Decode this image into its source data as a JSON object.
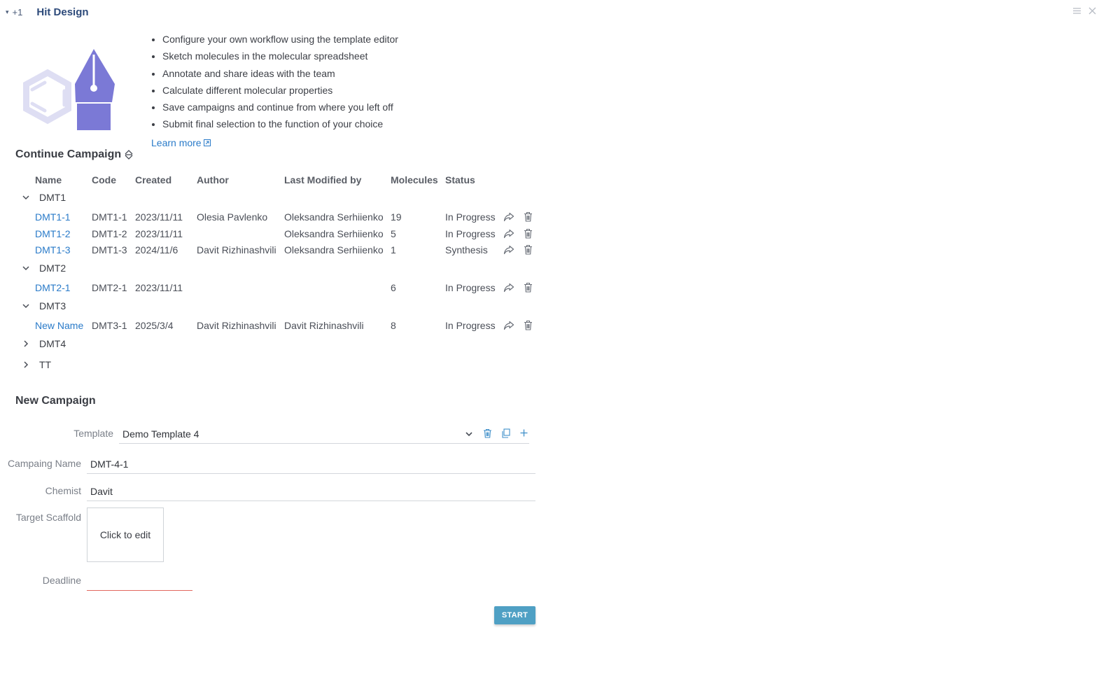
{
  "titlebar": {
    "caret": "▾",
    "plus": "+1",
    "title": "Hit Design"
  },
  "window_controls": {
    "menu_icon": "hamburger-icon",
    "close_icon": "close-icon"
  },
  "logo": {
    "icon": "hit-design-logo",
    "colors": {
      "pen": "#7b79d6",
      "hexagon": "#dedef3"
    }
  },
  "intro": {
    "bullets": [
      "Configure your own workflow using the template editor",
      "Sketch molecules in the molecular spreadsheet",
      "Annotate and share ideas with the team",
      "Calculate different molecular properties",
      "Save campaigns and continue from where you left off",
      "Submit final selection to the function of your choice"
    ],
    "learn_more": "Learn more"
  },
  "continue": {
    "title": "Continue Campaign",
    "columns": [
      "Name",
      "Code",
      "Created",
      "Author",
      "Last Modified by",
      "Molecules",
      "Status"
    ],
    "groups": [
      {
        "name": "DMT1",
        "expanded": true,
        "rows": [
          {
            "name": "DMT1-1",
            "code": "DMT1-1",
            "created": "2023/11/11",
            "author": "Olesia Pavlenko",
            "modified_by": "Oleksandra Serhiienko",
            "molecules": "19",
            "status": "In Progress"
          },
          {
            "name": "DMT1-2",
            "code": "DMT1-2",
            "created": "2023/11/11",
            "author": "",
            "modified_by": "Oleksandra Serhiienko",
            "molecules": "5",
            "status": "In Progress"
          },
          {
            "name": "DMT1-3",
            "code": "DMT1-3",
            "created": "2024/11/6",
            "author": "Davit Rizhinashvili",
            "modified_by": "Oleksandra Serhiienko",
            "molecules": "1",
            "status": "Synthesis"
          }
        ]
      },
      {
        "name": "DMT2",
        "expanded": true,
        "rows": [
          {
            "name": "DMT2-1",
            "code": "DMT2-1",
            "created": "2023/11/11",
            "author": "",
            "modified_by": "",
            "molecules": "6",
            "status": "In Progress"
          }
        ]
      },
      {
        "name": "DMT3",
        "expanded": true,
        "rows": [
          {
            "name": "New Name",
            "code": "DMT3-1",
            "created": "2025/3/4",
            "author": "Davit Rizhinashvili",
            "modified_by": "Davit Rizhinashvili",
            "molecules": "8",
            "status": "In Progress"
          }
        ]
      },
      {
        "name": "DMT4",
        "expanded": false,
        "rows": []
      },
      {
        "name": "TT",
        "expanded": false,
        "rows": []
      }
    ]
  },
  "new_campaign": {
    "title": "New Campaign",
    "template_label": "Template",
    "template_value": "Demo Template 4",
    "name_label": "Campaing Name",
    "name_value": "DMT-4-1",
    "chemist_label": "Chemist",
    "chemist_value": "Davit",
    "scaffold_label": "Target Scaffold",
    "scaffold_placeholder": "Click to edit",
    "deadline_label": "Deadline",
    "deadline_value": "",
    "start_label": "START"
  },
  "colors": {
    "link": "#2a7bc9",
    "start_button": "#4fa0c4",
    "deadline_error": "#e2675f",
    "title": "#2d4a7a"
  }
}
